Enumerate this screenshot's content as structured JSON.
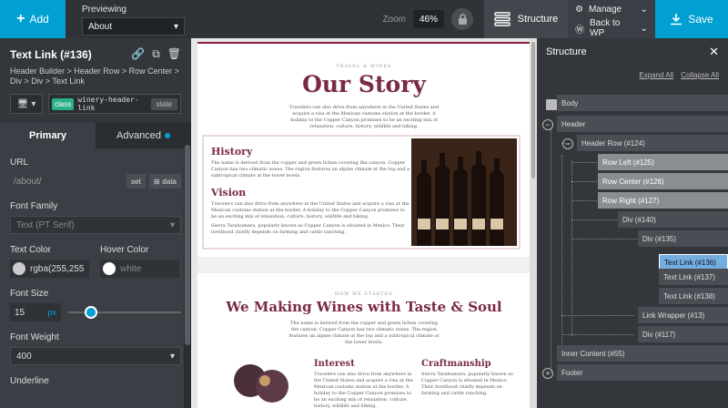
{
  "topbar": {
    "add_label": "Add",
    "previewing_label": "Previewing",
    "preview_value": "About",
    "zoom_label": "Zoom",
    "zoom_value": "46%",
    "structure_label": "Structure",
    "manage_label": "Manage",
    "back_label": "Back to WP",
    "save_label": "Save"
  },
  "element": {
    "title": "Text Link (#136)",
    "breadcrumb": "Header Builder > Header Row > Row Center > Div > Div > Text Link",
    "class_tag": "class",
    "class_name": "winery-header-link",
    "state_label": "state"
  },
  "tabs": {
    "primary": "Primary",
    "advanced": "Advanced"
  },
  "form": {
    "url_label": "URL",
    "url_placeholder": "/about/",
    "set_label": "set",
    "data_label": "data",
    "font_family_label": "Font Family",
    "font_family_value": "Text (PT Serif)",
    "text_color_label": "Text Color",
    "text_color_value": "rgba(255,255",
    "hover_color_label": "Hover Color",
    "hover_color_value": "white",
    "font_size_label": "Font Size",
    "font_size_value": "15",
    "font_size_unit": "px",
    "font_size_slider_fraction": 0.2,
    "font_weight_label": "Font Weight",
    "font_weight_value": "400",
    "underline_label": "Underline"
  },
  "canvas": {
    "story_kicker": "TRAVEL & WINES",
    "story_title": "Our Story",
    "story_body": "Travelers can also drive from anywhere in the United States and acquire a visa at the Mexican customs station at the border. A holiday to the Copper Canyon promises to be an exciting mix of relaxation, culture, history, wildlife and hiking.",
    "history_title": "History",
    "history_body": "The name is derived from the copper and green lichen covering the canyon. Copper Canyon has two climatic zones. The region features an alpine climate at the top and a subtropical climate at the lower levels.",
    "vision_title": "Vision",
    "vision_body": "Travelers can also drive from anywhere in the United States and acquire a visa at the Mexican customs station at the border. A holiday to the Copper Canyon promises to be an exciting mix of relaxation, culture, history, wildlife and hiking.",
    "vision_body2": "Sierra Tarahumara, popularly known as Copper Canyon is situated in Mexico. Their livelihood chiefly depends on farming and cattle ranching.",
    "wm_kicker": "HOW WE STARTED",
    "wm_title": "We Making Wines with Taste & Soul",
    "wm_body": "The name is derived from the copper and green lichen covering the canyon. Copper Canyon has two climatic zones. The region features an alpine climate at the top and a subtropical climate at the lower levels.",
    "interest_title": "Interest",
    "interest_body": "Travelers can also drive from anywhere in the United States and acquire a visa at the Mexican customs station at the border. A holiday to the Copper Canyon promises to be an exciting mix of relaxation, culture, history, wildlife and hiking.",
    "craft_title": "Craftmanship",
    "craft_body": "Sierra Tarahumara, popularly known as Copper Canyon is situated in Mexico. Their livelihood chiefly depends on farming and cattle ranching."
  },
  "structure": {
    "title": "Structure",
    "expand_all": "Expand All",
    "collapse_all": "Collapse All",
    "nodes": {
      "body": "Body",
      "header": "Header",
      "header_row": "Header Row (#124)",
      "row_left": "Row Left (#125)",
      "row_center": "Row Center (#126)",
      "row_right": "Row Right (#127)",
      "div140": "Div (#140)",
      "div135": "Div (#135)",
      "link136": "Text Link (#136)",
      "link137": "Text Link (#137)",
      "link138": "Text Link (#138)",
      "link_wrapper": "Link Wrapper (#13)",
      "div117": "Div (#117)",
      "inner_content": "Inner Content (#55)",
      "footer": "Footer"
    }
  },
  "colors": {
    "accent": "#00a0d2",
    "wine": "#7a2a44",
    "class_tag": "#2bb08a",
    "selected_node": "#74aee0"
  }
}
